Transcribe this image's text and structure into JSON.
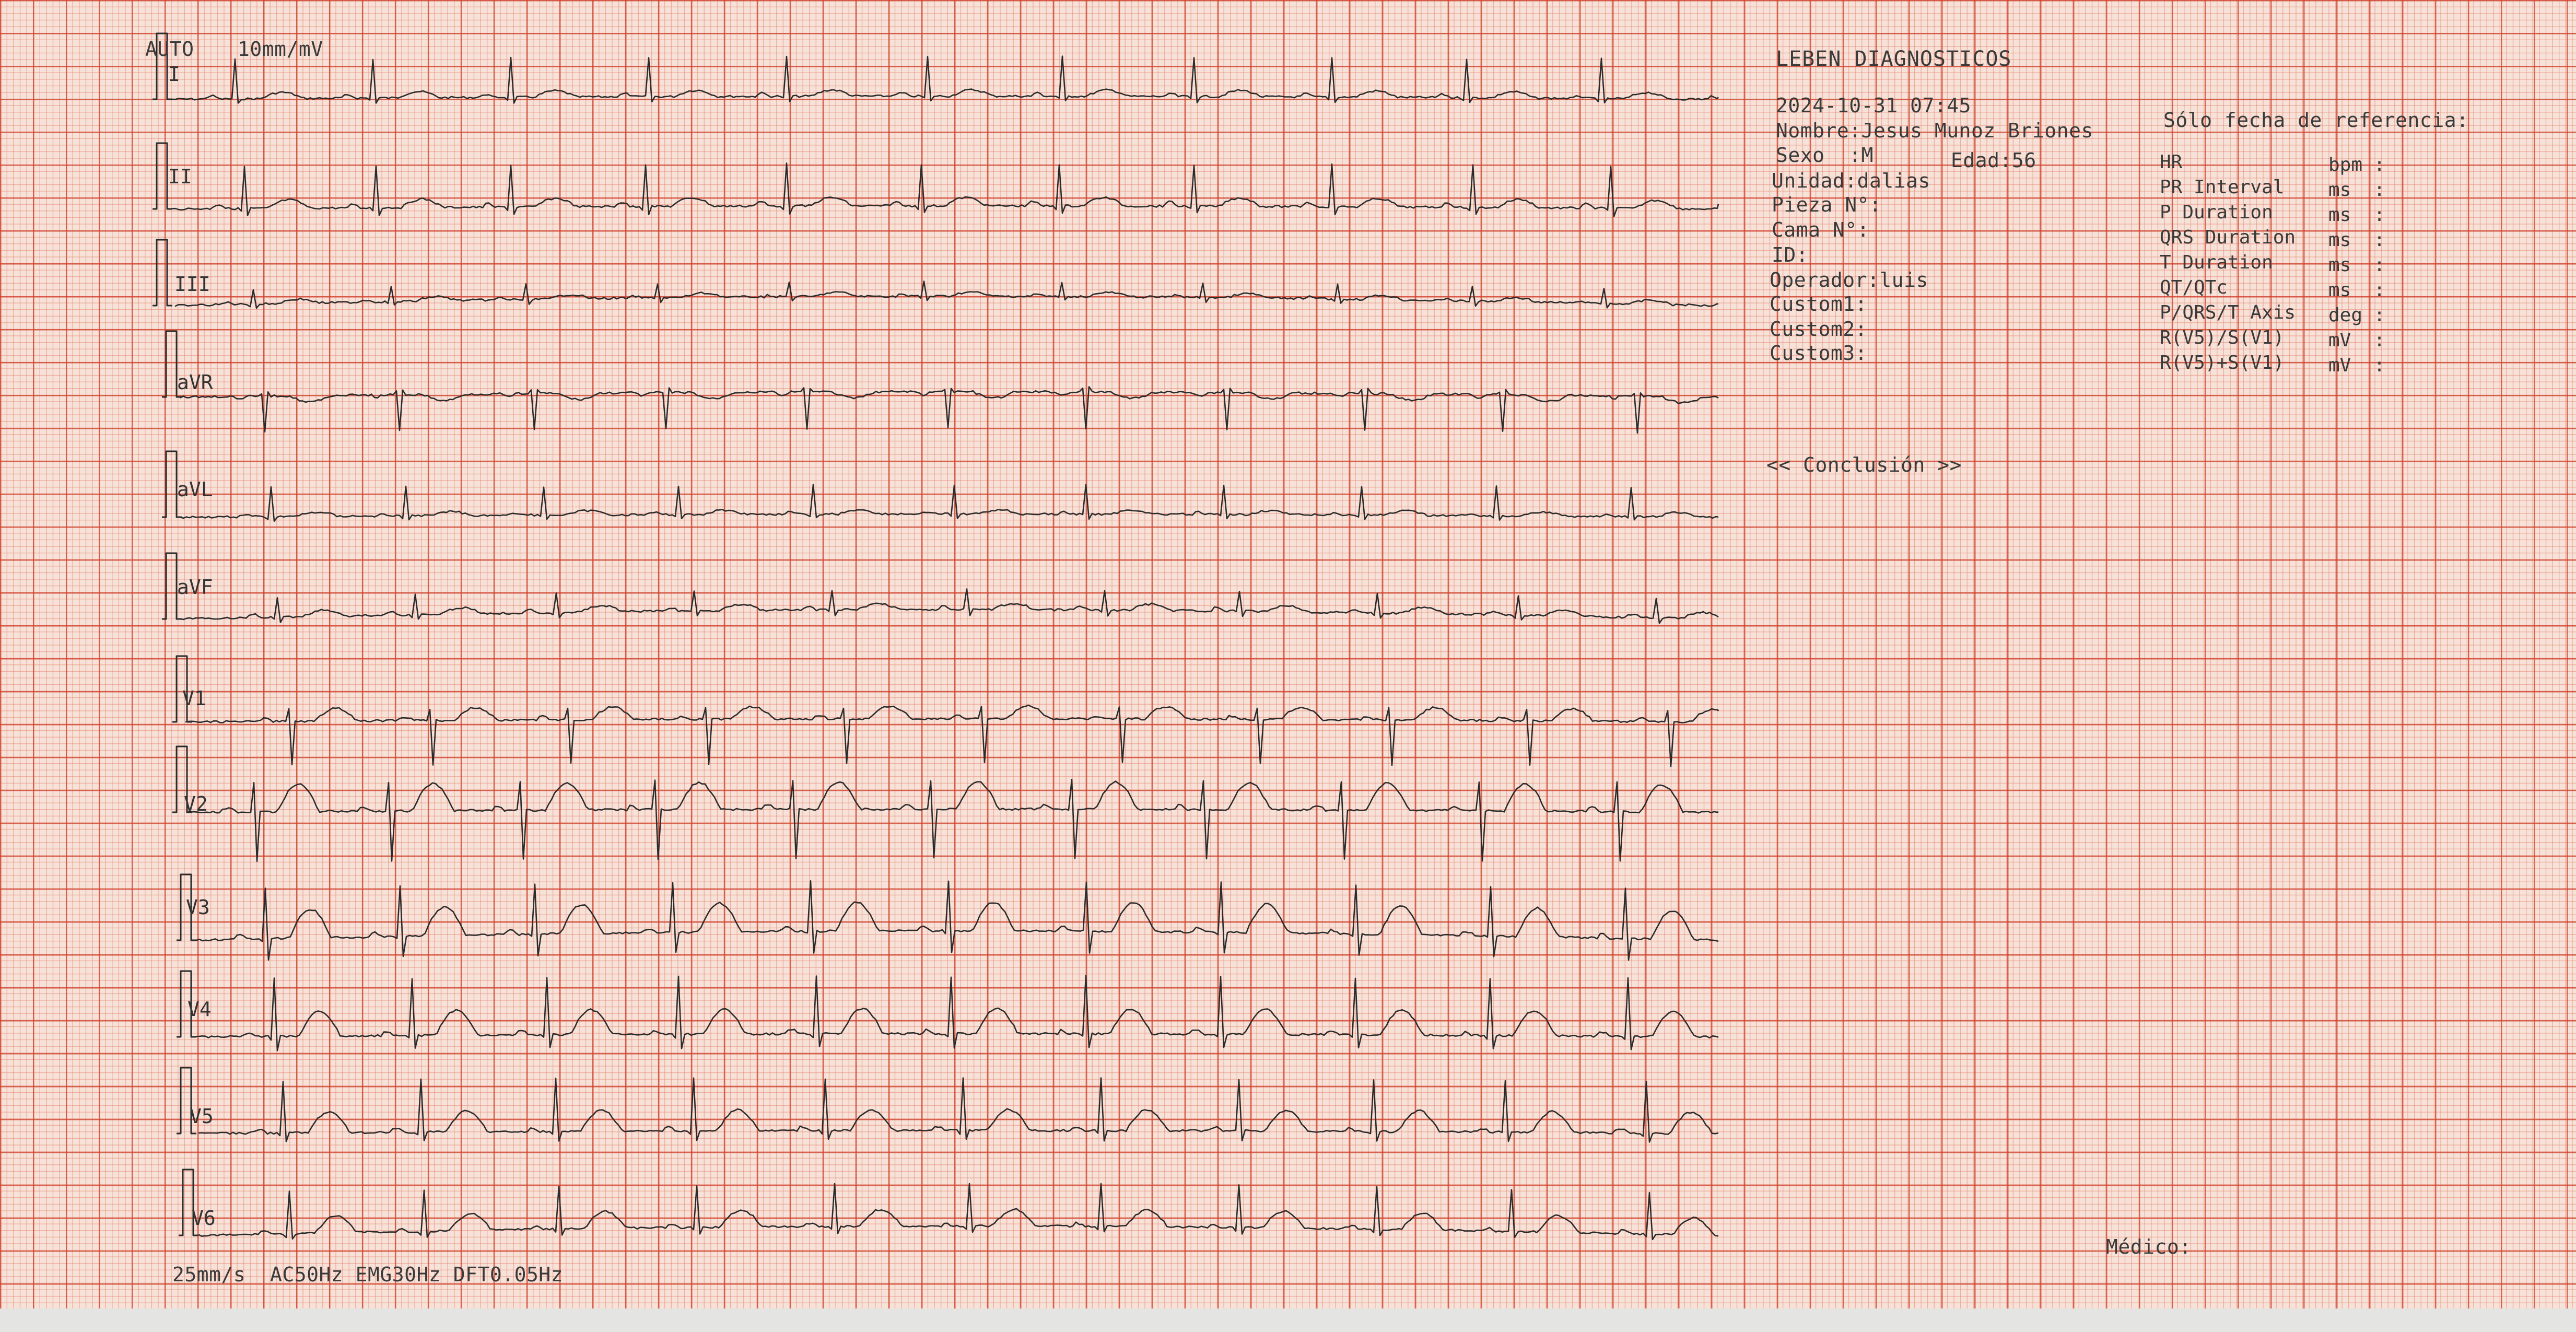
{
  "header": {
    "mode": "AUTO",
    "gain": "10mm/mV"
  },
  "footer": {
    "settings": "25mm/s  AC50Hz EMG30Hz DFT0.05Hz"
  },
  "leads": [
    {
      "name": "I",
      "trace": "lead-I"
    },
    {
      "name": "II",
      "trace": "lead-II"
    },
    {
      "name": "III",
      "trace": "lead-III"
    },
    {
      "name": "aVR",
      "trace": "lead-aVR"
    },
    {
      "name": "aVL",
      "trace": "lead-aVL"
    },
    {
      "name": "aVF",
      "trace": "lead-aVF"
    },
    {
      "name": "V1",
      "trace": "lead-V1"
    },
    {
      "name": "V2",
      "trace": "lead-V2"
    },
    {
      "name": "V3",
      "trace": "lead-V3"
    },
    {
      "name": "V4",
      "trace": "lead-V4"
    },
    {
      "name": "V5",
      "trace": "lead-V5"
    },
    {
      "name": "V6",
      "trace": "lead-V6"
    }
  ],
  "patient": {
    "clinic": "LEBEN DIAGNOSTICOS",
    "datetime": "2024-10-31 07:45",
    "name": "Nombre:Jesus Munoz Briones",
    "sex": "Sexo  :M",
    "age": "Edad:56",
    "unit": "Unidad:dalias",
    "room": "Pieza N°:",
    "bed": "Cama N°:",
    "id": "ID:",
    "operator": "Operador:luis",
    "custom1": "Custom1:",
    "custom2": "Custom2:",
    "custom3": "Custom3:"
  },
  "conclusion": "<< Conclusión >>",
  "reference": {
    "title": "Sólo fecha de referencia:",
    "rows": [
      {
        "label": "HR",
        "unit": "bpm :"
      },
      {
        "label": "PR Interval",
        "unit": "ms  :"
      },
      {
        "label": "P Duration",
        "unit": "ms  :"
      },
      {
        "label": "QRS Duration",
        "unit": "ms  :"
      },
      {
        "label": "T Duration",
        "unit": "ms  :"
      },
      {
        "label": "QT/QTc",
        "unit": "ms  :"
      },
      {
        "label": "P/QRS/T Axis",
        "unit": "deg :"
      },
      {
        "label": "R(V5)/S(V1)",
        "unit": "mV  :"
      },
      {
        "label": "R(V5)+S(V1)",
        "unit": "mV  :"
      }
    ]
  },
  "signature": "Médico:"
}
